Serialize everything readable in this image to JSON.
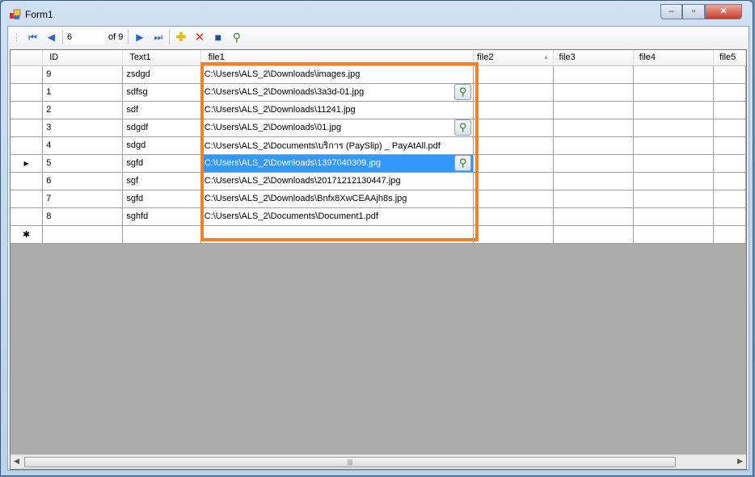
{
  "window": {
    "title": "Form1",
    "min": "–",
    "max": "▫",
    "close": "✕"
  },
  "toolbar": {
    "position": "6",
    "count": "of 9"
  },
  "columns": [
    "ID",
    "Text1",
    "file1",
    "file2",
    "file3",
    "file4",
    "file5"
  ],
  "rows": [
    {
      "id": "9",
      "text1": "zsdgd",
      "file1": "C:\\Users\\ALS_2\\Downloads\\images.jpg",
      "button": false
    },
    {
      "id": "1",
      "text1": "sdfsg",
      "file1": "C:\\Users\\ALS_2\\Downloads\\3a3d-01.jpg",
      "button": true
    },
    {
      "id": "2",
      "text1": "sdf",
      "file1": "C:\\Users\\ALS_2\\Downloads\\11241.jpg",
      "button": false
    },
    {
      "id": "3",
      "text1": "sdgdf",
      "file1": "C:\\Users\\ALS_2\\Downloads\\01.jpg",
      "button": true
    },
    {
      "id": "4",
      "text1": "sdgd",
      "file1": "C:\\Users\\ALS_2\\Documents\\บริการ (PaySlip) _ PayAtAll.pdf",
      "button": false
    },
    {
      "id": "5",
      "text1": "sgfd",
      "file1": "C:\\Users\\ALS_2\\Downloads\\1397040309.jpg",
      "button": true,
      "selected": true
    },
    {
      "id": "6",
      "text1": "sgf",
      "file1": "C:\\Users\\ALS_2\\Downloads\\20171212130447.jpg",
      "button": false
    },
    {
      "id": "7",
      "text1": "sgfd",
      "file1": "C:\\Users\\ALS_2\\Downloads\\Bnfx8XwCEAAjh8s.jpg",
      "button": false
    },
    {
      "id": "8",
      "text1": "sghfd",
      "file1": "C:\\Users\\ALS_2\\Documents\\Document1.pdf",
      "button": false
    }
  ],
  "highlight_color": "#f48024",
  "selection_color": "#3399ff"
}
